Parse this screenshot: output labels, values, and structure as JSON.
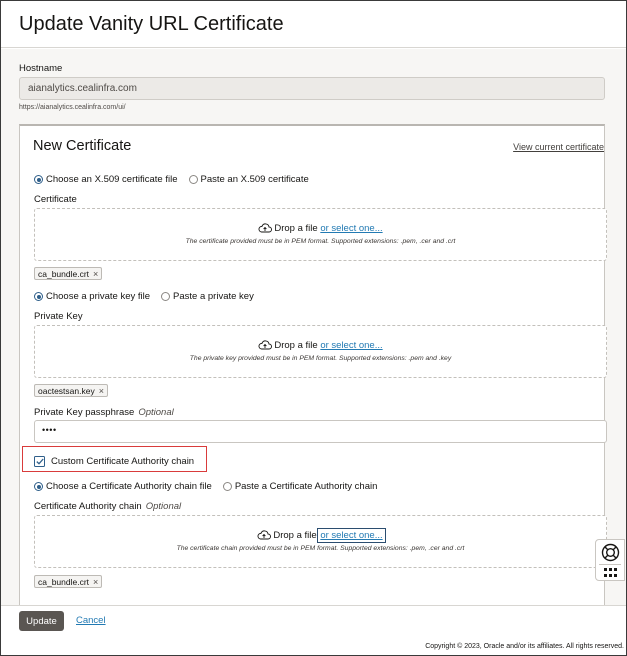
{
  "dialog": {
    "title": "Update Vanity URL Certificate"
  },
  "hostname": {
    "label": "Hostname",
    "value": "aianalytics.cealinfra.com",
    "hint": "https://aianalytics.cealinfra.com/ui/"
  },
  "new_certificate": {
    "title": "New Certificate",
    "view_current_link": "View current certificate",
    "cert_source": {
      "options": [
        "Choose an X.509 certificate file",
        "Paste an X.509 certificate"
      ],
      "selected": "Choose an X.509 certificate file"
    },
    "certificate": {
      "label": "Certificate",
      "drop_text": "Drop a file",
      "select_link": "or select one...",
      "help": "The certificate provided must be in PEM format. Supported extensions: .pem, .cer and .crt",
      "file": "ca_bundle.crt"
    },
    "key_source": {
      "options": [
        "Choose a private key file",
        "Paste a private key"
      ],
      "selected": "Choose a private key file"
    },
    "private_key": {
      "label": "Private Key",
      "drop_text": "Drop a file",
      "select_link": "or select one...",
      "help": "The private key provided must be in PEM format. Supported extensions: .pem and .key",
      "file": "oactestsan.key"
    },
    "passphrase": {
      "label": "Private Key passphrase",
      "optional": "Optional",
      "value": "••••"
    },
    "custom_ca": {
      "label": "Custom Certificate Authority chain",
      "checked": true
    },
    "ca_source": {
      "options": [
        "Choose a Certificate Authority chain file",
        "Paste a Certificate Authority chain"
      ],
      "selected": "Choose a Certificate Authority chain file"
    },
    "ca_chain": {
      "label": "Certificate Authority chain",
      "optional": "Optional",
      "drop_text": "Drop a file",
      "select_link": "or select one...",
      "help": "The certificate chain provided must be in PEM format. Supported extensions: .pem, .cer and .crt",
      "file": "ca_bundle.crt"
    }
  },
  "footer": {
    "update_label": "Update",
    "cancel_label": "Cancel",
    "copyright": "Copyright © 2023, Oracle and/or its affiliates. All rights reserved."
  },
  "icons": {
    "upload": "cloud-upload-icon",
    "remove": "close-icon",
    "help": "lifebuoy-icon",
    "grid": "grid-dots-icon"
  },
  "colors": {
    "accent": "#2f5f8a",
    "link": "#227ab3",
    "highlight": "#d93b3b",
    "primary_button": "#5a5652"
  }
}
